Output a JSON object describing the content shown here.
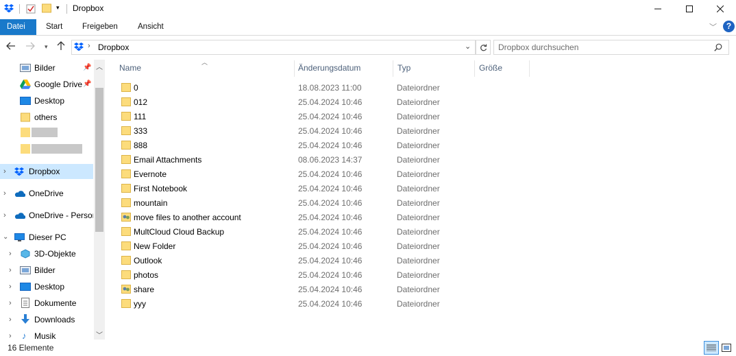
{
  "window": {
    "title": "Dropbox",
    "minimize_icon": "minimize-icon",
    "maximize_icon": "maximize-icon",
    "close_icon": "close-icon"
  },
  "ribbon": {
    "tabs": [
      "Datei",
      "Start",
      "Freigeben",
      "Ansicht"
    ],
    "active_tab": "Datei",
    "help": "?",
    "accent": "#1979ca"
  },
  "address": {
    "path": "Dropbox",
    "search_placeholder": "Dropbox durchsuchen"
  },
  "sidebar": {
    "quick_access": [
      {
        "label": "Bilder",
        "icon": "pictures-icon",
        "pinned": true
      },
      {
        "label": "Google Drive",
        "icon": "google-drive-icon",
        "pinned": true
      },
      {
        "label": "Desktop",
        "icon": "desktop-icon",
        "pinned": false
      },
      {
        "label": "others",
        "icon": "folder-icon",
        "pinned": false
      }
    ],
    "locations": [
      {
        "label": "Dropbox",
        "icon": "dropbox-icon",
        "selected": true
      },
      {
        "label": "OneDrive",
        "icon": "onedrive-icon"
      },
      {
        "label": "OneDrive - Persor",
        "icon": "onedrive-icon"
      },
      {
        "label": "Dieser PC",
        "icon": "pc-icon",
        "expanded": true
      }
    ],
    "pc_children": [
      {
        "label": "3D-Objekte",
        "icon": "3d-objects-icon"
      },
      {
        "label": "Bilder",
        "icon": "pictures-icon"
      },
      {
        "label": "Desktop",
        "icon": "desktop-icon"
      },
      {
        "label": "Dokumente",
        "icon": "documents-icon"
      },
      {
        "label": "Downloads",
        "icon": "downloads-icon"
      },
      {
        "label": "Musik",
        "icon": "music-icon"
      }
    ]
  },
  "columns": {
    "name": "Name",
    "date": "Änderungsdatum",
    "type": "Typ",
    "size": "Größe"
  },
  "files": [
    {
      "name": "0",
      "date": "18.08.2023 11:00",
      "type": "Dateiordner",
      "icon": "folder-icon"
    },
    {
      "name": "012",
      "date": "25.04.2024 10:46",
      "type": "Dateiordner",
      "icon": "folder-icon"
    },
    {
      "name": "111",
      "date": "25.04.2024 10:46",
      "type": "Dateiordner",
      "icon": "folder-icon"
    },
    {
      "name": "333",
      "date": "25.04.2024 10:46",
      "type": "Dateiordner",
      "icon": "folder-icon"
    },
    {
      "name": "888",
      "date": "25.04.2024 10:46",
      "type": "Dateiordner",
      "icon": "folder-icon"
    },
    {
      "name": "Email Attachments",
      "date": "08.06.2023 14:37",
      "type": "Dateiordner",
      "icon": "folder-icon"
    },
    {
      "name": "Evernote",
      "date": "25.04.2024 10:46",
      "type": "Dateiordner",
      "icon": "folder-icon"
    },
    {
      "name": "First Notebook",
      "date": "25.04.2024 10:46",
      "type": "Dateiordner",
      "icon": "folder-icon"
    },
    {
      "name": "mountain",
      "date": "25.04.2024 10:46",
      "type": "Dateiordner",
      "icon": "folder-icon"
    },
    {
      "name": "move files to another account",
      "date": "25.04.2024 10:46",
      "type": "Dateiordner",
      "icon": "shared-folder-icon"
    },
    {
      "name": "MultCloud Cloud Backup",
      "date": "25.04.2024 10:46",
      "type": "Dateiordner",
      "icon": "folder-icon"
    },
    {
      "name": "New Folder",
      "date": "25.04.2024 10:46",
      "type": "Dateiordner",
      "icon": "folder-icon"
    },
    {
      "name": "Outlook",
      "date": "25.04.2024 10:46",
      "type": "Dateiordner",
      "icon": "folder-icon"
    },
    {
      "name": "photos",
      "date": "25.04.2024 10:46",
      "type": "Dateiordner",
      "icon": "folder-icon"
    },
    {
      "name": "share",
      "date": "25.04.2024 10:46",
      "type": "Dateiordner",
      "icon": "shared-folder-icon"
    },
    {
      "name": "yyy",
      "date": "25.04.2024 10:46",
      "type": "Dateiordner",
      "icon": "folder-icon"
    }
  ],
  "status": {
    "count_text": "16 Elemente"
  }
}
